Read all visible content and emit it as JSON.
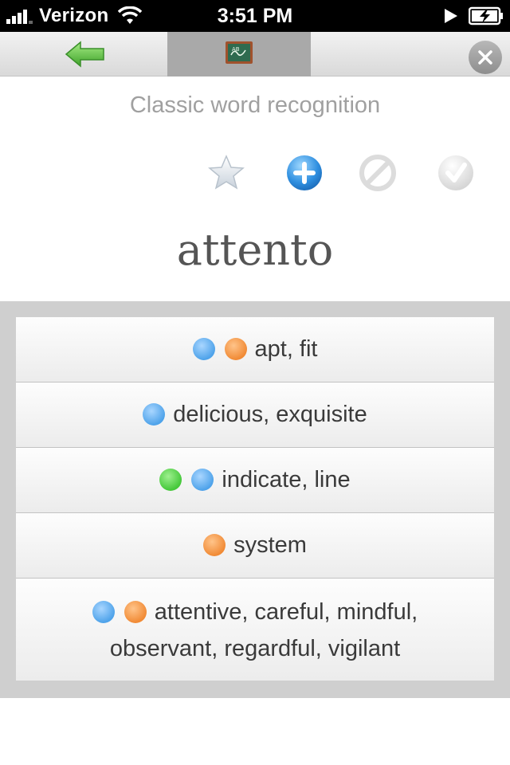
{
  "status_bar": {
    "carrier": "Verizon",
    "time": "3:51 PM"
  },
  "toolbar": {
    "back_icon": "back-arrow-icon",
    "center_icon": "chalkboard-icon",
    "close_icon": "close-icon"
  },
  "header": {
    "subtitle": "Classic word recognition",
    "actions": [
      {
        "icon": "star-icon"
      },
      {
        "icon": "plus-icon"
      },
      {
        "icon": "block-icon"
      },
      {
        "icon": "check-icon"
      }
    ]
  },
  "word": "attento",
  "answers": [
    {
      "dots": [
        "blue",
        "orange"
      ],
      "text": "apt, fit"
    },
    {
      "dots": [
        "blue"
      ],
      "text": "delicious, exquisite"
    },
    {
      "dots": [
        "green",
        "blue"
      ],
      "text": "indicate, line"
    },
    {
      "dots": [
        "orange"
      ],
      "text": "system"
    },
    {
      "dots": [
        "blue",
        "orange"
      ],
      "text_line1": "attentive, careful, mindful,",
      "text_line2": "observant, regardful, vigilant"
    }
  ],
  "colors": {
    "blue": "#4fa3ea",
    "orange": "#f18b36",
    "green": "#45c83a",
    "toolbar_center_bg": "#a9a9a9",
    "panel_bg": "#cfcfcf"
  }
}
